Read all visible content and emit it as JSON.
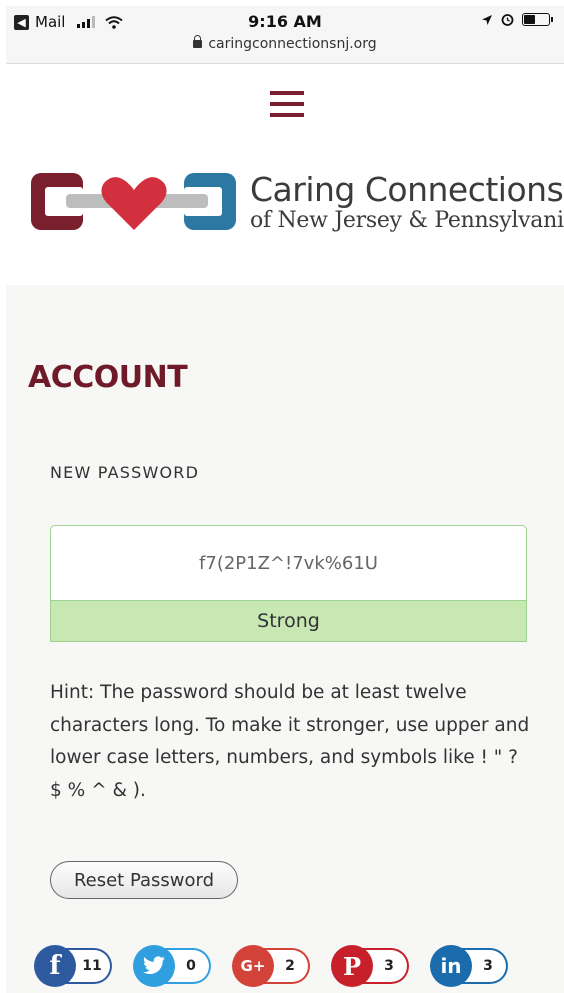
{
  "status_bar": {
    "back_app": "Mail",
    "time": "9:16 AM",
    "url": "caringconnectionsnj.org"
  },
  "logo": {
    "line1": "Caring Connections",
    "line2": "of New Jersey & Pennsylvania"
  },
  "page": {
    "title": "ACCOUNT",
    "new_password_label": "NEW PASSWORD",
    "password_value": "f7(2P1Z^!7vk%61U",
    "strength": "Strong",
    "hint": "Hint: The password should be at least twelve characters long. To make it stronger, use upper and lower case letters, numbers, and symbols like ! \" ? $ % ^ & ).",
    "reset_button": "Reset Password"
  },
  "share": [
    {
      "network": "facebook",
      "icon": "facebook-icon",
      "glyph": "f",
      "count": "11",
      "color": "#2d5a9e"
    },
    {
      "network": "twitter",
      "icon": "twitter-icon",
      "glyph": "t",
      "count": "0",
      "color": "#2f9fe0"
    },
    {
      "network": "google-plus",
      "icon": "google-plus-icon",
      "glyph": "G+",
      "count": "2",
      "color": "#d4433a"
    },
    {
      "network": "pinterest",
      "icon": "pinterest-icon",
      "glyph": "P",
      "count": "3",
      "color": "#c8202a"
    },
    {
      "network": "linkedin",
      "icon": "linkedin-icon",
      "glyph": "in",
      "count": "3",
      "color": "#1a6cad"
    }
  ],
  "colors": {
    "brand_maroon": "#7a1f2e",
    "heart_red": "#d2303f",
    "chain_blue": "#2c78a3",
    "strength_green": "#c7e7b3"
  }
}
